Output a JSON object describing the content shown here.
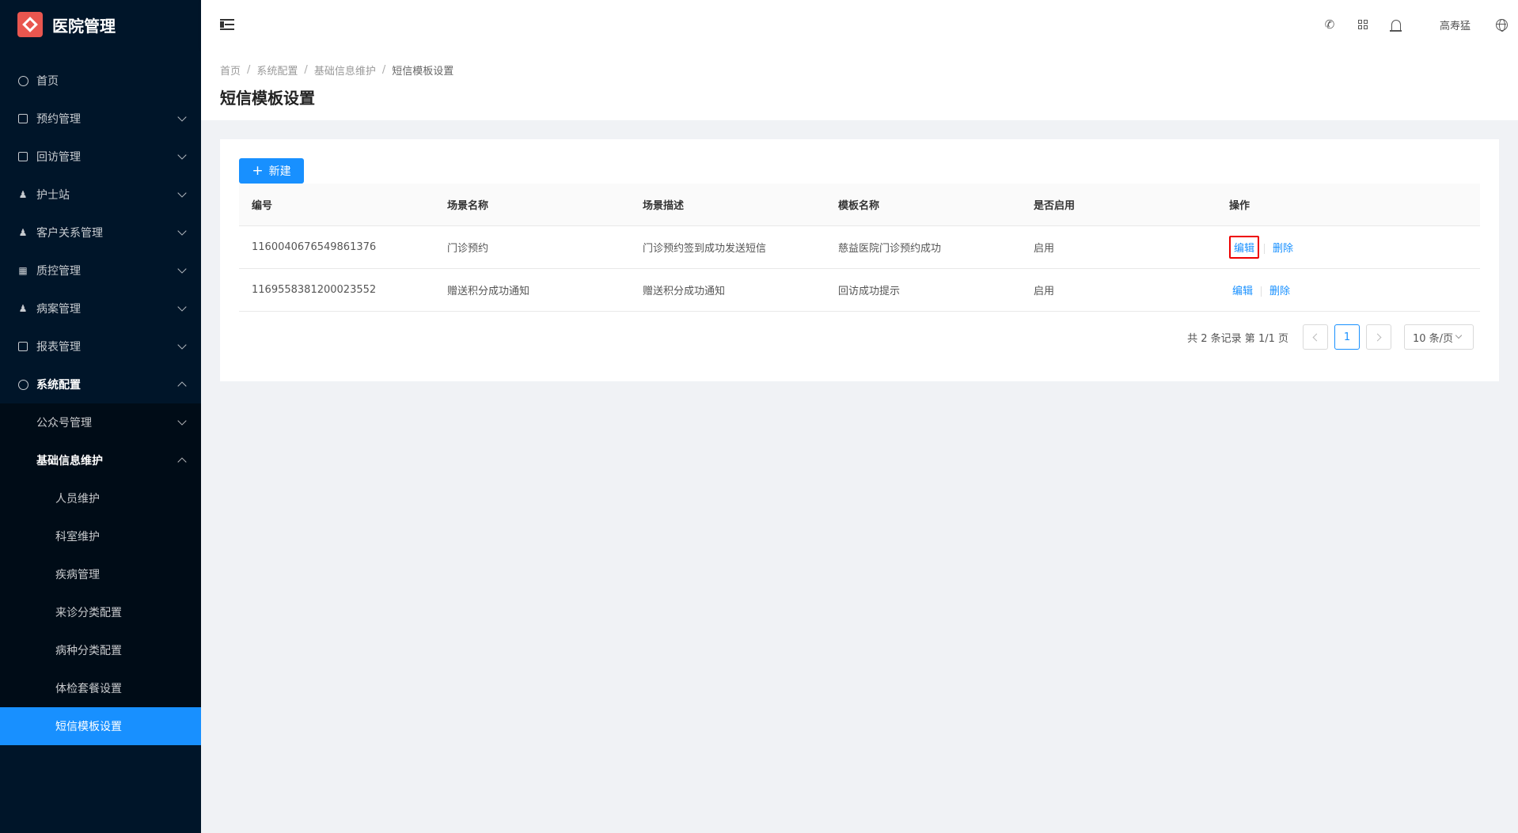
{
  "app": {
    "title": "医院管理"
  },
  "sidebar": {
    "items": [
      {
        "label": "首页",
        "icon": "dashboard-icon"
      },
      {
        "label": "预约管理",
        "icon": "edit-icon"
      },
      {
        "label": "回访管理",
        "icon": "lock-icon"
      },
      {
        "label": "护士站",
        "icon": "user-icon"
      },
      {
        "label": "客户关系管理",
        "icon": "user-icon"
      },
      {
        "label": "质控管理",
        "icon": "table-icon"
      },
      {
        "label": "病案管理",
        "icon": "user-icon"
      },
      {
        "label": "报表管理",
        "icon": "edit-icon"
      },
      {
        "label": "系统配置",
        "icon": "dashboard-icon"
      }
    ],
    "system_sub": [
      {
        "label": "公众号管理"
      },
      {
        "label": "基础信息维护"
      }
    ],
    "basic_sub": [
      {
        "label": "人员维护"
      },
      {
        "label": "科室维护"
      },
      {
        "label": "疾病管理"
      },
      {
        "label": "来诊分类配置"
      },
      {
        "label": "病种分类配置"
      },
      {
        "label": "体检套餐设置"
      },
      {
        "label": "短信模板设置"
      }
    ]
  },
  "header": {
    "user_name": "高寿猛"
  },
  "breadcrumb": [
    "首页",
    "系统配置",
    "基础信息维护",
    "短信模板设置"
  ],
  "page_title": "短信模板设置",
  "toolbar": {
    "new_label": "新建"
  },
  "table": {
    "columns": [
      "编号",
      "场景名称",
      "场景描述",
      "模板名称",
      "是否启用",
      "操作"
    ],
    "rows": [
      {
        "id": "1160040676549861376",
        "scene": "门诊预约",
        "desc": "门诊预约签到成功发送短信",
        "template": "慈益医院门诊预约成功",
        "enabled": "启用",
        "edit": "编辑",
        "delete": "删除"
      },
      {
        "id": "1169558381200023552",
        "scene": "赠送积分成功通知",
        "desc": "赠送积分成功通知",
        "template": "回访成功提示",
        "enabled": "启用",
        "edit": "编辑",
        "delete": "删除"
      }
    ]
  },
  "pagination": {
    "total_text": "共 2 条记录 第 1/1 页",
    "current": "1",
    "page_size": "10 条/页"
  }
}
